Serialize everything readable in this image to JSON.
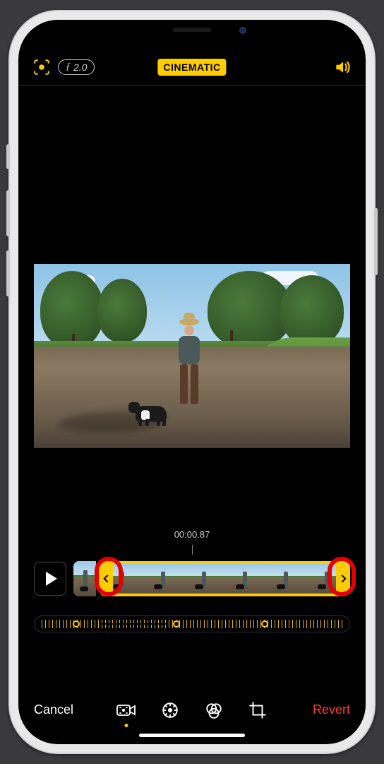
{
  "header": {
    "fstop_prefix": "ƒ",
    "fstop_value": "2.0",
    "mode_badge": "CINEMATIC"
  },
  "timeline": {
    "timestamp": "00:00.87",
    "thumb_count": 6
  },
  "footer": {
    "cancel_label": "Cancel",
    "revert_label": "Revert"
  },
  "colors": {
    "accent": "#FFCC00",
    "destructive": "#ff3b30"
  }
}
